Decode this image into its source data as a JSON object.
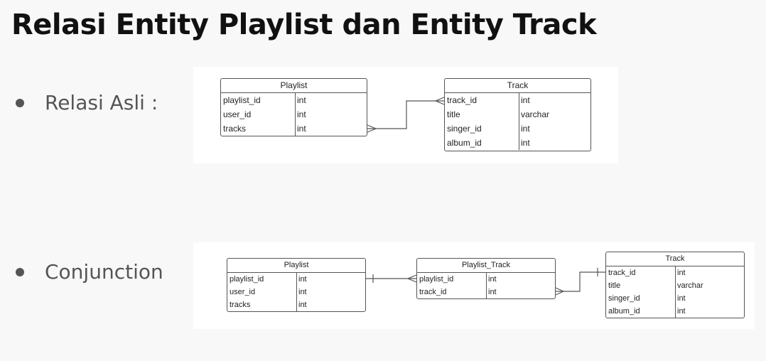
{
  "title": "Relasi Entity Playlist dan Entity Track",
  "sections": [
    {
      "label": "Relasi Asli :",
      "entities": [
        {
          "name": "Playlist",
          "rows": [
            {
              "name": "playlist_id",
              "type": "int"
            },
            {
              "name": "user_id",
              "type": "int"
            },
            {
              "name": "tracks",
              "type": "int"
            }
          ]
        },
        {
          "name": "Track",
          "rows": [
            {
              "name": "track_id",
              "type": "int"
            },
            {
              "name": "title",
              "type": "varchar"
            },
            {
              "name": "singer_id",
              "type": "int"
            },
            {
              "name": "album_id",
              "type": "int"
            }
          ]
        }
      ],
      "relations": [
        {
          "from": "Playlist.tracks",
          "to": "Track.track_id",
          "from_end": "many",
          "to_end": "many"
        }
      ]
    },
    {
      "label": "Conjunction",
      "entities": [
        {
          "name": "Playlist",
          "rows": [
            {
              "name": "playlist_id",
              "type": "int"
            },
            {
              "name": "user_id",
              "type": "int"
            },
            {
              "name": "tracks",
              "type": "int"
            }
          ]
        },
        {
          "name": "Playlist_Track",
          "rows": [
            {
              "name": "playlist_id",
              "type": "int"
            },
            {
              "name": "track_id",
              "type": "int"
            }
          ]
        },
        {
          "name": "Track",
          "rows": [
            {
              "name": "track_id",
              "type": "int"
            },
            {
              "name": "title",
              "type": "varchar"
            },
            {
              "name": "singer_id",
              "type": "int"
            },
            {
              "name": "album_id",
              "type": "int"
            }
          ]
        }
      ],
      "relations": [
        {
          "from": "Playlist.playlist_id",
          "to": "Playlist_Track.playlist_id",
          "from_end": "one",
          "to_end": "many"
        },
        {
          "from": "Playlist_Track.track_id",
          "to": "Track.track_id",
          "from_end": "many",
          "to_end": "one"
        }
      ]
    }
  ]
}
